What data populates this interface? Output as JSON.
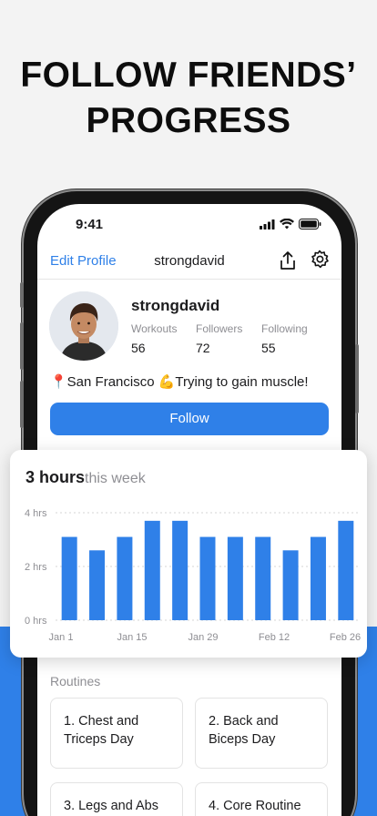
{
  "headline": {
    "line1": "FOLLOW FRIENDS’",
    "line2": "PROGRESS"
  },
  "status_bar": {
    "time": "9:41"
  },
  "nav": {
    "edit_profile": "Edit Profile",
    "title": "strongdavid"
  },
  "profile": {
    "username": "strongdavid",
    "stats": [
      {
        "label": "Workouts",
        "value": "56"
      },
      {
        "label": "Followers",
        "value": "72"
      },
      {
        "label": "Following",
        "value": "55"
      }
    ],
    "bio": "📍San Francisco 💪Trying to gain muscle!",
    "follow_label": "Follow"
  },
  "weekly": {
    "hours": "3 hours",
    "suffix": "this week"
  },
  "chart_data": {
    "type": "bar",
    "ylim": [
      0,
      4
    ],
    "y_ticks": [
      "0 hrs",
      "2 hrs",
      "4 hrs"
    ],
    "x_ticks": [
      "Jan 1",
      "Jan 15",
      "Jan 29",
      "Feb 12",
      "Feb 26"
    ],
    "values": [
      3.1,
      2.6,
      3.1,
      3.7,
      3.7,
      3.1,
      3.1,
      3.1,
      2.6,
      3.1,
      3.7
    ],
    "color": "#2f80e8"
  },
  "routines": {
    "label": "Routines",
    "items": [
      {
        "name": "1. Chest and Triceps Day"
      },
      {
        "name": "2. Back and Biceps Day"
      },
      {
        "name": "3. Legs and Abs"
      },
      {
        "name": "4. Core Routine"
      }
    ]
  },
  "colors": {
    "accent": "#2f80e8",
    "background": "#f3f3f3"
  }
}
